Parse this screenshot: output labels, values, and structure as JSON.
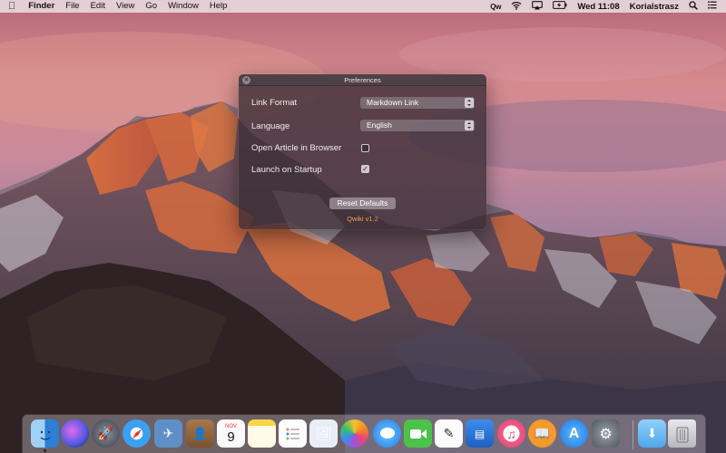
{
  "menubar": {
    "app_name": "Finder",
    "menus": [
      "File",
      "Edit",
      "View",
      "Go",
      "Window",
      "Help"
    ],
    "status": {
      "qw_text": "Qw",
      "clock": "Wed 11:08",
      "user": "Korialstrasz"
    }
  },
  "window": {
    "title": "Preferences",
    "link_format": {
      "label": "Link Format",
      "value": "Markdown Link"
    },
    "language": {
      "label": "Language",
      "value": "English"
    },
    "open_in_browser": {
      "label": "Open Article in Browser",
      "checked": false
    },
    "launch_on_startup": {
      "label": "Launch on Startup",
      "checked": true
    },
    "reset_label": "Reset Defaults",
    "version": "Qwiki v1.2",
    "accent_color": "#f0a04b"
  },
  "dock": {
    "calendar_month": "NOV",
    "calendar_day": "9",
    "items": [
      "finder-icon",
      "siri-icon",
      "launchpad-icon",
      "safari-icon",
      "mail-stamp-icon",
      "contacts-icon",
      "calendar-icon",
      "notes-icon",
      "reminders-icon",
      "preview-icon",
      "photos-icon",
      "messages-icon",
      "facetime-icon",
      "textedit-icon",
      "keynote-icon",
      "itunes-icon",
      "ibooks-icon",
      "app-store-icon",
      "system-preferences-icon",
      "downloads-folder-icon",
      "trash-icon"
    ]
  }
}
